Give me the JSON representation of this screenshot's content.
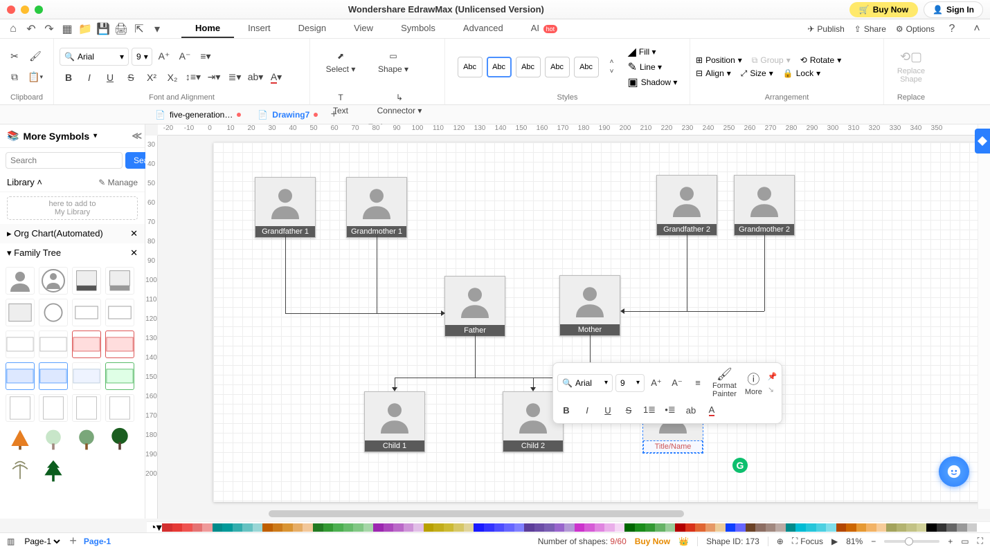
{
  "titlebar": {
    "title": "Wondershare EdrawMax (Unlicensed Version)",
    "buy_now": "Buy Now",
    "sign_in": "Sign In"
  },
  "menu": {
    "tabs": [
      "Home",
      "Insert",
      "Design",
      "View",
      "Symbols",
      "Advanced",
      "AI"
    ],
    "active": "Home",
    "hot_label": "hot",
    "right": {
      "publish": "Publish",
      "share": "Share",
      "options": "Options"
    }
  },
  "ribbon": {
    "clipboard_label": "Clipboard",
    "font_label": "Font and Alignment",
    "font_name": "Arial",
    "font_size": "9",
    "tools_label": "Tools",
    "select_label": "Select",
    "shape_label": "Shape",
    "text_label": "Text",
    "connector_label": "Connector",
    "styles_label": "Styles",
    "style_preview": "Abc",
    "fill_label": "Fill",
    "line_label": "Line",
    "shadow_label": "Shadow",
    "arrangement_label": "Arrangement",
    "position_label": "Position",
    "group_label": "Group",
    "rotate_label": "Rotate",
    "align_label": "Align",
    "size_label": "Size",
    "lock_label": "Lock",
    "replace_label": "Replace",
    "replace_shape_label": "Replace\nShape"
  },
  "tabs": {
    "doc1": "five-generation…",
    "doc2": "Drawing7"
  },
  "ruler_h": [
    "-20",
    "-10",
    "0",
    "10",
    "20",
    "30",
    "40",
    "50",
    "60",
    "70",
    "80",
    "90",
    "100",
    "110",
    "120",
    "130",
    "140",
    "150",
    "160",
    "170",
    "180",
    "190",
    "200",
    "210",
    "220",
    "230",
    "240",
    "250",
    "260",
    "270",
    "280",
    "290",
    "300",
    "310",
    "320",
    "330",
    "340",
    "350"
  ],
  "ruler_v": [
    "30",
    "40",
    "50",
    "60",
    "70",
    "80",
    "90",
    "100",
    "110",
    "120",
    "130",
    "140",
    "150",
    "160",
    "170",
    "180",
    "190",
    "200"
  ],
  "left": {
    "title": "More Symbols",
    "search_placeholder": "Search",
    "search_btn": "Search",
    "library_label": "Library",
    "manage_label": "Manage",
    "mylib_hint": "here to add to\nMy Library",
    "section_org": "Org Chart(Automated)",
    "section_family": "Family Tree"
  },
  "canvas": {
    "people": {
      "gf1": "Grandfather 1",
      "gm1": "Grandmother 1",
      "gf2": "Grandfather 2",
      "gm2": "Grandmother 2",
      "father": "Father",
      "mother": "Mother",
      "child1": "Child 1",
      "child2": "Child 2"
    },
    "editing_text": "Title/Name"
  },
  "float": {
    "font_name": "Arial",
    "font_size": "9",
    "format": "Format\nPainter",
    "more": "More"
  },
  "status": {
    "page_combo": "Page-1",
    "add_page": "+",
    "active_page": "Page-1",
    "shapes_label": "Number of shapes: ",
    "shapes_value": "9/60",
    "buy_now": "Buy Now",
    "shape_id_label": "Shape ID: ",
    "shape_id_value": "173",
    "focus": "Focus",
    "zoom": "81%"
  },
  "colours": [
    "#d32f2f",
    "#e53935",
    "#ef5350",
    "#e57373",
    "#ef9a9a",
    "#008b8b",
    "#009999",
    "#33adad",
    "#66c2c2",
    "#99d6d6",
    "#bf5f00",
    "#cc7a1a",
    "#d99433",
    "#e6ad66",
    "#f2c799",
    "#227a22",
    "#339933",
    "#4caf50",
    "#66bb6a",
    "#81c784",
    "#a5d6a7",
    "#9c27b0",
    "#ab47bc",
    "#ba68c8",
    "#ce93d8",
    "#e1bee7",
    "#b8a000",
    "#c2ad1a",
    "#ccba33",
    "#d6c766",
    "#e0d499",
    "#1a1aff",
    "#3333ff",
    "#4d4dff",
    "#6666ff",
    "#8080ff",
    "#5c3d99",
    "#6b4da6",
    "#7a5eb3",
    "#9966cc",
    "#b399d6",
    "#cc33cc",
    "#d65cd6",
    "#e085e0",
    "#eaaeea",
    "#f5d6f5",
    "#006600",
    "#1a8c1a",
    "#339933",
    "#66b366",
    "#99cc99",
    "#b30000",
    "#d9331a",
    "#e06633",
    "#e69966",
    "#eccc99",
    "#0f3fff",
    "#6666ff",
    "#6b4226",
    "#8d6e63",
    "#a1887f",
    "#bcaaa4",
    "#008b8b",
    "#00bcd4",
    "#26c6da",
    "#4dd0e1",
    "#80deea",
    "#b34700",
    "#cc6600",
    "#e69933",
    "#f2b366",
    "#f7cc99",
    "#a3a35c",
    "#b3b370",
    "#c2c285",
    "#d1d199",
    "#000000",
    "#333333",
    "#666666",
    "#999999",
    "#cccccc",
    "#ffffff"
  ]
}
